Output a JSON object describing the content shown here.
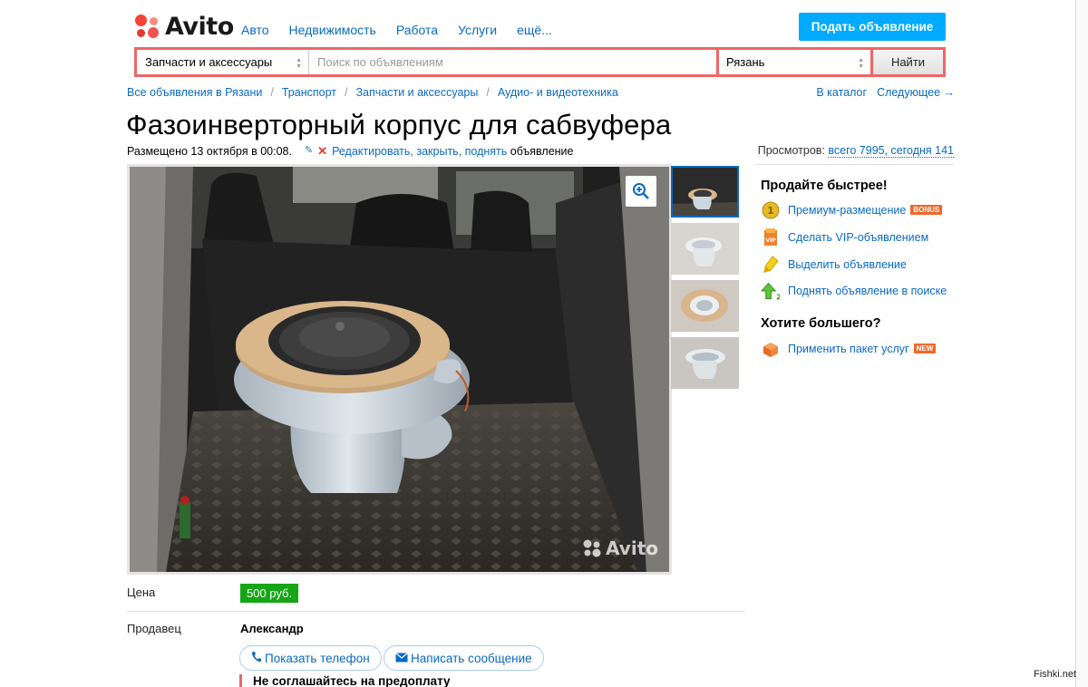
{
  "header": {
    "logo": "Avito",
    "nav": [
      "Авто",
      "Недвижимость",
      "Работа",
      "Услуги",
      "ещё..."
    ],
    "post_button": "Подать объявление"
  },
  "search": {
    "category": "Запчасти и аксессуары",
    "placeholder": "Поиск по объявлениям",
    "city": "Рязань",
    "button": "Найти"
  },
  "breadcrumbs": [
    "Все объявления в Рязани",
    "Транспорт",
    "Запчасти и аксессуары",
    "Аудио- и видеотехника"
  ],
  "catalog_nav": {
    "catalog": "В каталог",
    "next": "Следующее →"
  },
  "listing": {
    "title": "Фазоинверторный корпус для сабвуфера",
    "placed": "Размещено 13 октября в 00:08.",
    "actions": "Редактировать, закрыть, поднять",
    "actions_suffix": "объявление",
    "views_label": "Просмотров:",
    "views_value": "всего 7995, сегодня 141",
    "watermark": "Avito",
    "price_label": "Цена",
    "price": "500 руб.",
    "seller_label": "Продавец",
    "seller": "Александр",
    "phone_button": "Показать телефон",
    "message_button": "Написать сообщение",
    "warning": "Не соглашайтесь на предоплату"
  },
  "sidebar": {
    "heading1": "Продайте быстрее!",
    "items": [
      {
        "label": "Премиум-размещение",
        "badge": "BONUS",
        "icon": "coin-icon"
      },
      {
        "label": "Сделать VIP-объявлением",
        "badge": "",
        "icon": "vip-icon"
      },
      {
        "label": "Выделить объявление",
        "badge": "",
        "icon": "marker-icon"
      },
      {
        "label": "Поднять объявление в поиске",
        "badge": "",
        "icon": "up-arrow-icon"
      }
    ],
    "heading2": "Хотите большего?",
    "package": {
      "label": "Применить пакет услуг",
      "badge": "NEW",
      "icon": "package-icon"
    }
  },
  "credit": "Fishki.net",
  "colors": {
    "accent": "#00aaff",
    "link": "#0a6ac2",
    "search_border": "#f06666",
    "price_bg": "#15a515",
    "badge": "#f0682a"
  }
}
